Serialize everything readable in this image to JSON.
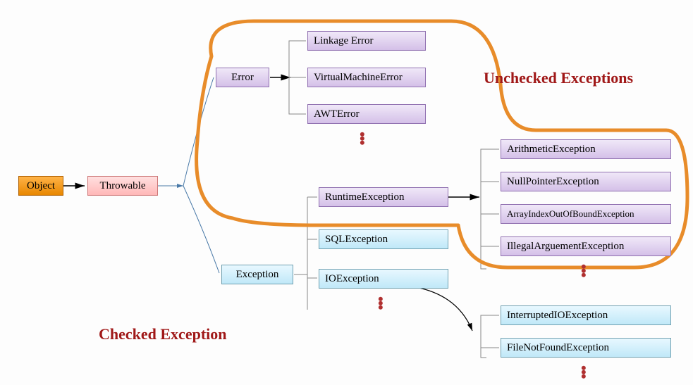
{
  "root": {
    "label": "Object"
  },
  "throwable": {
    "label": "Throwable"
  },
  "error": {
    "label": "Error",
    "children": [
      "Linkage Error",
      "VirtualMachineError",
      "AWTError"
    ]
  },
  "exception": {
    "label": "Exception",
    "runtime": {
      "label": "RuntimeException",
      "children": [
        "ArithmeticException",
        "NullPointerException",
        "ArrayIndexOutOfBoundException",
        "IllegalArguementException"
      ]
    },
    "sql": {
      "label": "SQLException"
    },
    "io": {
      "label": "IOException",
      "children": [
        "InterruptedIOException",
        "FileNotFoundException"
      ]
    }
  },
  "annotations": {
    "unchecked": "Unchecked Exceptions",
    "checked": "Checked Exception"
  }
}
